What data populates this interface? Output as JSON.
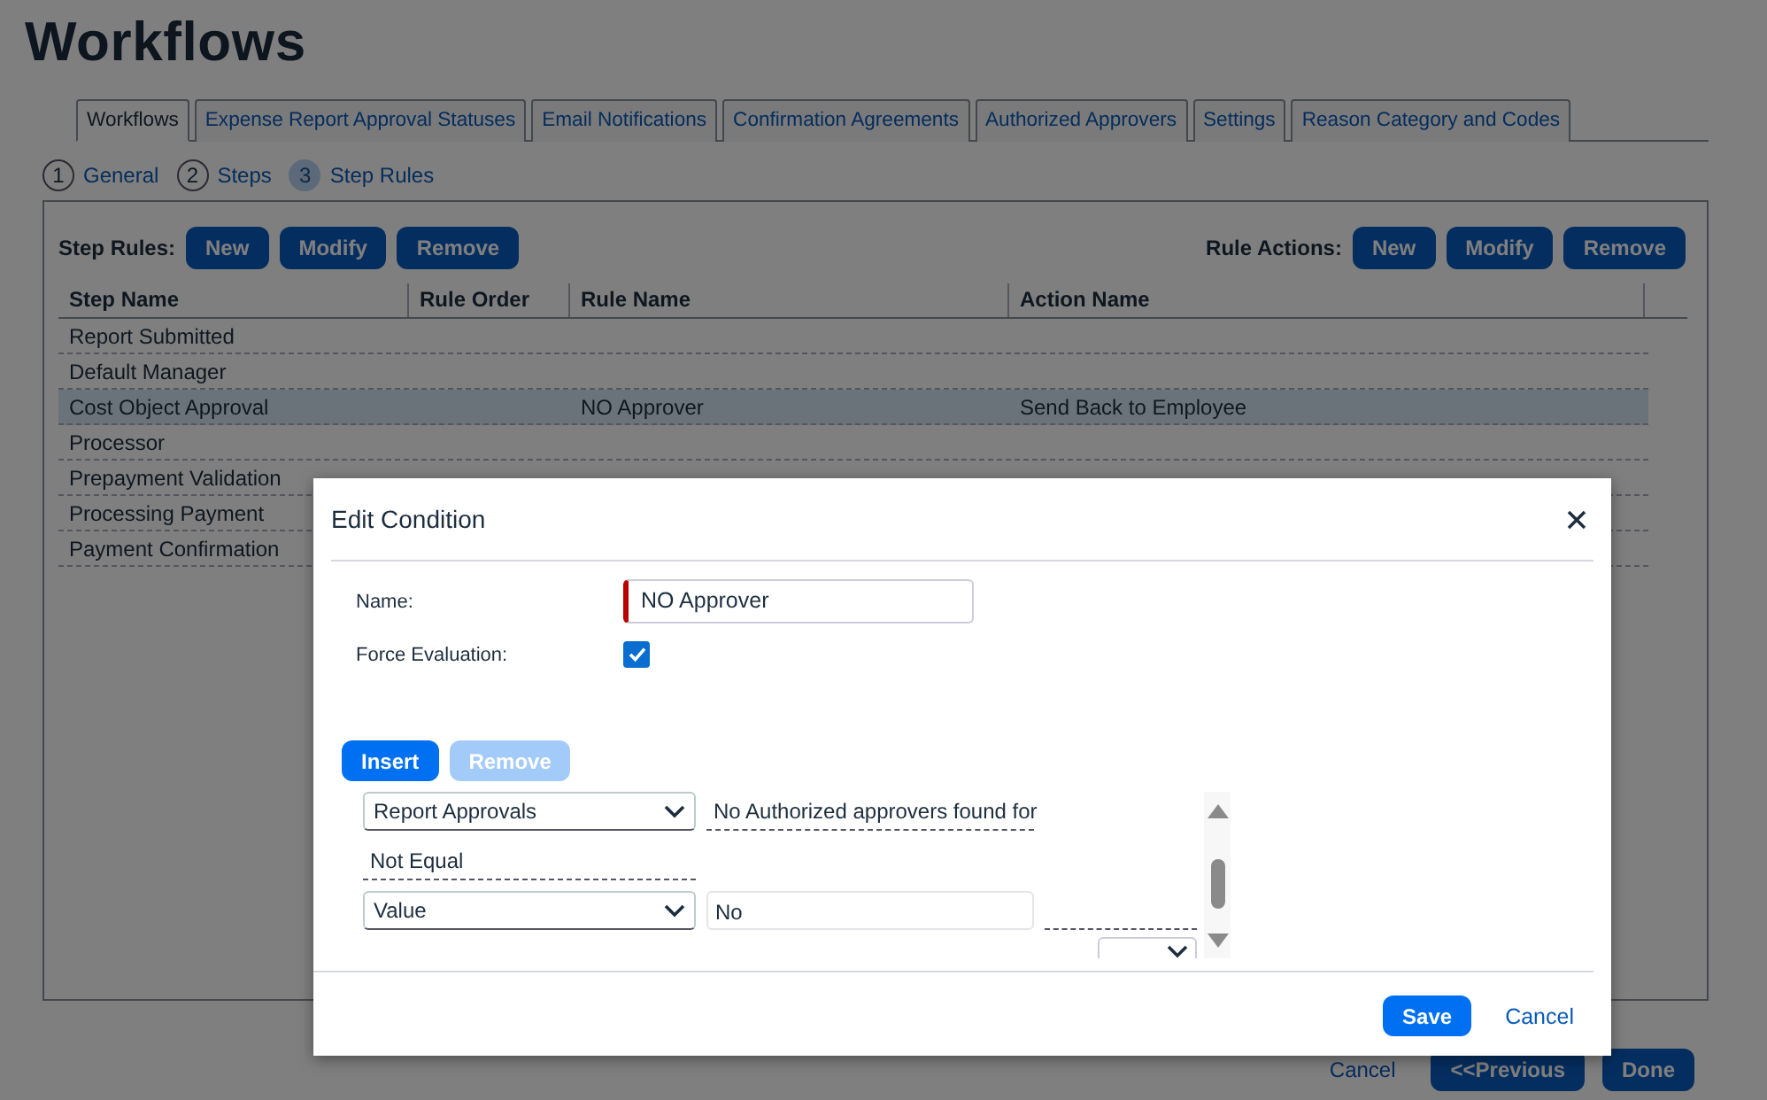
{
  "page_title": "Workflows",
  "tabs": [
    {
      "label": "Workflows",
      "selected": true
    },
    {
      "label": "Expense Report Approval Statuses",
      "selected": false
    },
    {
      "label": "Email Notifications",
      "selected": false
    },
    {
      "label": "Confirmation Agreements",
      "selected": false
    },
    {
      "label": "Authorized Approvers",
      "selected": false
    },
    {
      "label": "Settings",
      "selected": false
    },
    {
      "label": "Reason Category and Codes",
      "selected": false
    }
  ],
  "steps": [
    {
      "number": "1",
      "label": "General",
      "selected": false
    },
    {
      "number": "2",
      "label": "Steps",
      "selected": false
    },
    {
      "number": "3",
      "label": "Step Rules",
      "selected": true
    }
  ],
  "step_rules": {
    "label": "Step Rules:",
    "buttons": [
      "New",
      "Modify",
      "Remove"
    ]
  },
  "rule_actions": {
    "label": "Rule Actions:",
    "buttons": [
      "New",
      "Modify",
      "Remove"
    ]
  },
  "table": {
    "columns": [
      "Step Name",
      "Rule Order",
      "Rule Name",
      "Action Name"
    ],
    "rows": [
      {
        "cells": [
          "Report Submitted",
          "",
          "",
          ""
        ],
        "selected": false
      },
      {
        "cells": [
          "Default Manager",
          "",
          "",
          ""
        ],
        "selected": false
      },
      {
        "cells": [
          "Cost Object Approval",
          "",
          "NO Approver",
          "Send Back to Employee"
        ],
        "selected": true
      },
      {
        "cells": [
          "Processor",
          "",
          "",
          ""
        ],
        "selected": false
      },
      {
        "cells": [
          "Prepayment Validation",
          "",
          "",
          ""
        ],
        "selected": false
      },
      {
        "cells": [
          "Processing Payment",
          "",
          "",
          ""
        ],
        "selected": false
      },
      {
        "cells": [
          "Payment Confirmation",
          "",
          "",
          ""
        ],
        "selected": false
      }
    ]
  },
  "footer": {
    "cancel": "Cancel",
    "previous": "<<Previous",
    "done": "Done"
  },
  "dialog": {
    "title": "Edit Condition",
    "name_label": "Name:",
    "name_value": "NO Approver",
    "name_required": true,
    "force_label": "Force Evaluation:",
    "force_checked": true,
    "buttons": [
      {
        "label": "Insert",
        "disabled": false
      },
      {
        "label": "Remove",
        "disabled": true
      }
    ],
    "condition_rows": [
      [
        {
          "kind": "select",
          "value": "Report Approvals"
        },
        {
          "kind": "text",
          "value": "No Authorized approvers found for"
        }
      ],
      [
        {
          "kind": "text",
          "value": "Not Equal"
        }
      ],
      [
        {
          "kind": "select",
          "value": "Value"
        },
        {
          "kind": "input",
          "value": "No"
        },
        {
          "kind": "blank"
        }
      ],
      [
        {
          "kind": "small-select"
        }
      ]
    ],
    "save": "Save",
    "cancel": "Cancel"
  }
}
